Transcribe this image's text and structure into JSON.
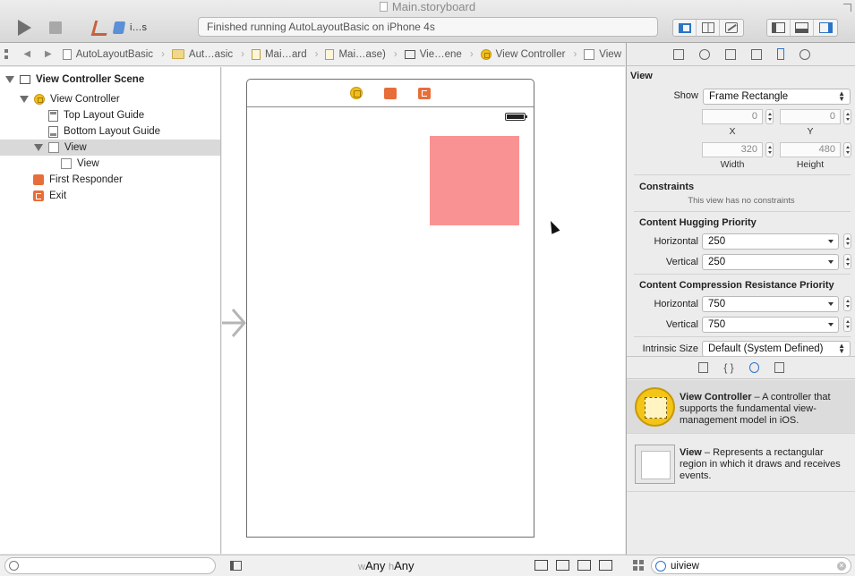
{
  "window": {
    "title": "Main.storyboard"
  },
  "toolbar": {
    "scheme_label": "i…s",
    "activity_text": "Finished running AutoLayoutBasic on iPhone 4s"
  },
  "jumpbar": {
    "crumbs": [
      "AutoLayoutBasic",
      "Aut…asic",
      "Mai…ard",
      "Mai…ase)",
      "Vie…ene",
      "View Controller",
      "View"
    ]
  },
  "outline": {
    "items": [
      {
        "label": "View Controller Scene"
      },
      {
        "label": "View Controller"
      },
      {
        "label": "Top Layout Guide"
      },
      {
        "label": "Bottom Layout Guide"
      },
      {
        "label": "View"
      },
      {
        "label": "View"
      },
      {
        "label": "First Responder"
      },
      {
        "label": "Exit"
      }
    ]
  },
  "canvas": {
    "size_class_w": "w",
    "size_class_w_value": "Any",
    "size_class_h": "h",
    "size_class_h_value": "Any",
    "pink_view_color": "#f99393"
  },
  "inspector": {
    "view_section": "View",
    "show_label": "Show",
    "show_value": "Frame Rectangle",
    "x_value": "0",
    "y_value": "0",
    "x_label": "X",
    "y_label": "Y",
    "width_value": "320",
    "height_value": "480",
    "width_label": "Width",
    "height_label": "Height",
    "constraints_title": "Constraints",
    "constraints_note": "This view has no constraints",
    "hugging_title": "Content Hugging Priority",
    "hugging_h_label": "Horizontal",
    "hugging_h_value": "250",
    "hugging_v_label": "Vertical",
    "hugging_v_value": "250",
    "compression_title": "Content Compression Resistance Priority",
    "compression_h_label": "Horizontal",
    "compression_h_value": "750",
    "compression_v_label": "Vertical",
    "compression_v_value": "750",
    "intrinsic_label": "Intrinsic Size",
    "intrinsic_value": "Default (System Defined)"
  },
  "library": {
    "items": [
      {
        "name": "View Controller",
        "description": " – A controller that supports the fundamental view-management model in iOS."
      },
      {
        "name": "View",
        "description": " – Represents a rectangular region in which it draws and receives events."
      }
    ],
    "search_value": "uiview"
  }
}
